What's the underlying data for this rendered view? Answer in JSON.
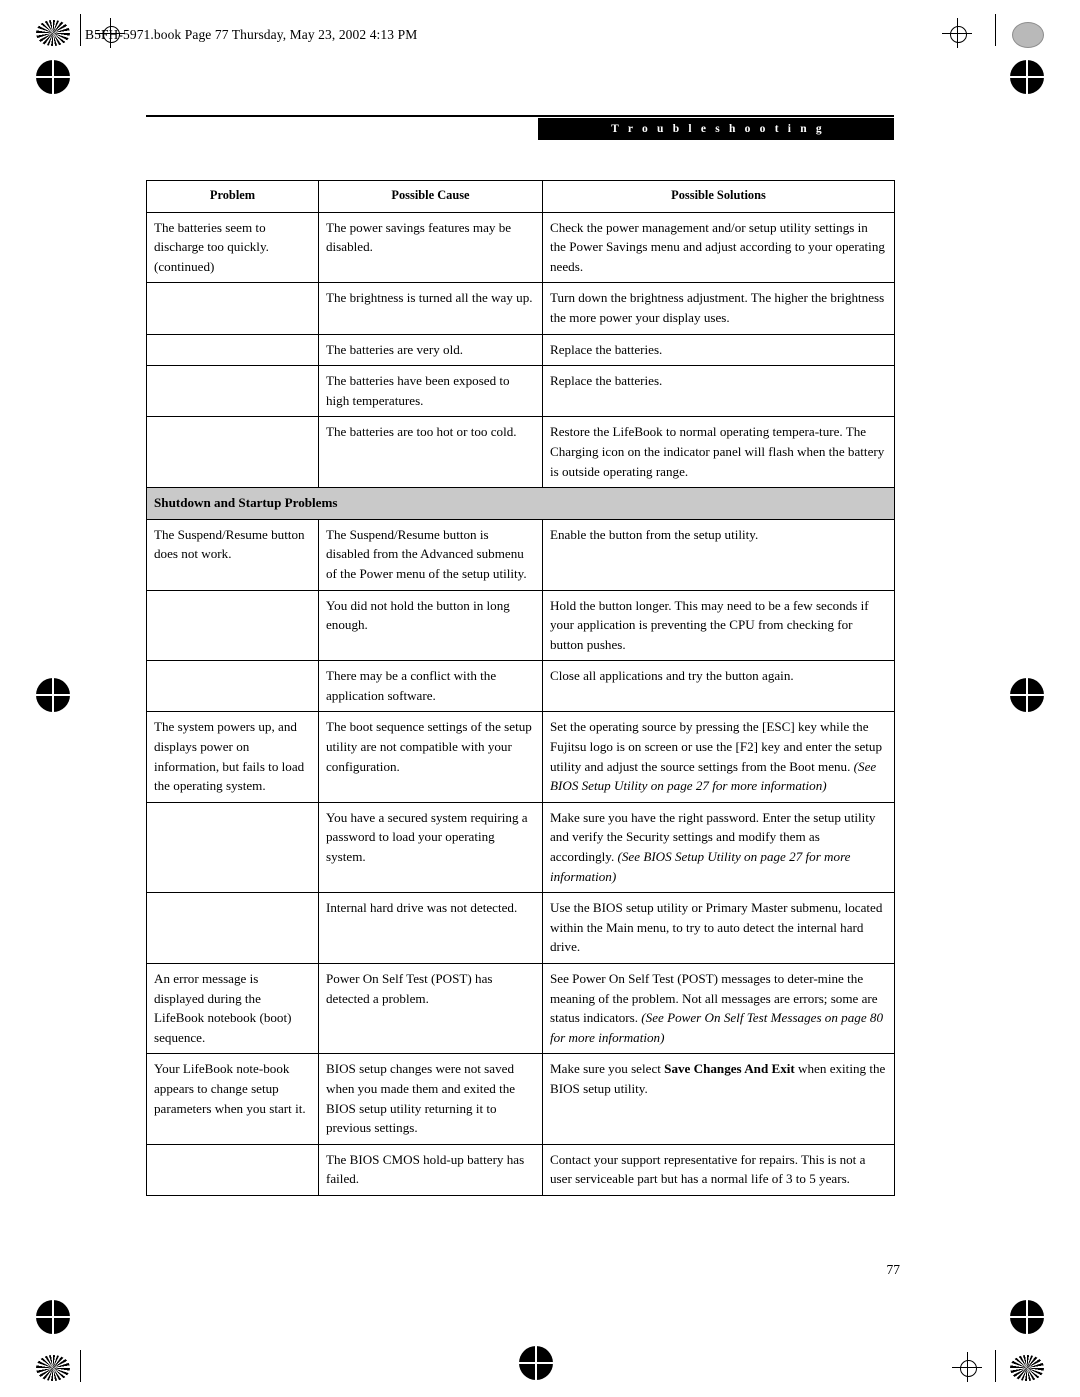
{
  "header": {
    "text": "B5FH-5971.book  Page 77  Thursday, May 23, 2002  4:13 PM"
  },
  "chapter_tab": "T r o u b l e s h o o t i n g",
  "page_number": "77",
  "table": {
    "columns": [
      "Problem",
      "Possible Cause",
      "Possible Solutions"
    ],
    "rows": [
      {
        "problem": "The batteries seem to discharge too quickly. (continued)",
        "cause": "The power savings features may be disabled.",
        "solution": "Check the power management and/or setup utility settings in the Power Savings menu and adjust according to your operating needs."
      },
      {
        "problem": "",
        "cause": "The brightness is turned all the way up.",
        "solution": "Turn down the brightness adjustment. The higher the brightness the more power your display uses."
      },
      {
        "problem": "",
        "cause": "The batteries are very old.",
        "solution": "Replace the batteries."
      },
      {
        "problem": "",
        "cause": "The batteries have been exposed to high temperatures.",
        "solution": "Replace the batteries."
      },
      {
        "problem": "",
        "cause": "The batteries are too hot or too cold.",
        "solution": "Restore the LifeBook to normal operating tempera-ture. The Charging icon on the indicator panel will flash when the battery is outside operating range."
      }
    ],
    "section_heading": "Shutdown and Startup Problems",
    "rows2": [
      {
        "problem": "The Suspend/Resume button does not work.",
        "cause": "The Suspend/Resume button is disabled from the Advanced submenu of the Power menu of the setup utility.",
        "solution": "Enable the button from the setup utility."
      },
      {
        "problem": "",
        "cause": "You did not hold the button in long enough.",
        "solution": "Hold the button longer. This may need to be a few seconds if your application is preventing the CPU from checking for button pushes."
      },
      {
        "problem": "",
        "cause": "There may be a conflict with the application software.",
        "solution": "Close all applications and try the button again."
      },
      {
        "problem": "The system powers up, and displays power on information, but fails to load the operating system.",
        "cause": "The boot sequence settings of the setup utility are not compatible with your configuration.",
        "solution_plain": "Set the operating source by pressing the [ESC] key while the Fujitsu logo is on screen or use the [F2] key and enter the setup utility and adjust the source settings from the Boot menu. ",
        "solution_italic": "(See BIOS Setup Utility on page 27 for more information)"
      },
      {
        "problem": "",
        "cause": "You have a secured system requiring a password to load your operating system.",
        "solution_plain": "Make sure you have the right password. Enter the setup utility and verify the Security settings and modify them as accordingly. ",
        "solution_italic": "(See BIOS Setup Utility on page 27 for more information)"
      },
      {
        "problem": "",
        "cause": "Internal hard drive was not detected.",
        "solution": "Use the BIOS setup utility or Primary Master submenu, located within the Main menu, to try to auto detect the internal hard drive."
      },
      {
        "problem": "An error message is displayed during the LifeBook notebook (boot) sequence.",
        "cause": "Power On Self Test (POST) has detected a problem.",
        "solution_plain": "See Power On Self Test (POST) messages to deter-mine the meaning of the problem. Not all messages are errors; some are status indicators. ",
        "solution_italic": "(See Power On Self Test Messages on page 80 for more information)"
      },
      {
        "problem": "Your LifeBook note-book appears to change setup parameters when you start it.",
        "cause": "BIOS setup changes were not saved when you made them and exited the BIOS setup utility returning it to previous settings.",
        "solution_pre": "Make sure you select ",
        "solution_bold": "Save Changes And Exit",
        "solution_post": " when exiting the BIOS setup utility."
      },
      {
        "problem": "",
        "cause": "The BIOS CMOS hold-up battery has failed.",
        "solution": "Contact your support representative for repairs. This is not a user serviceable part but has a normal life of 3 to 5 years."
      }
    ]
  }
}
